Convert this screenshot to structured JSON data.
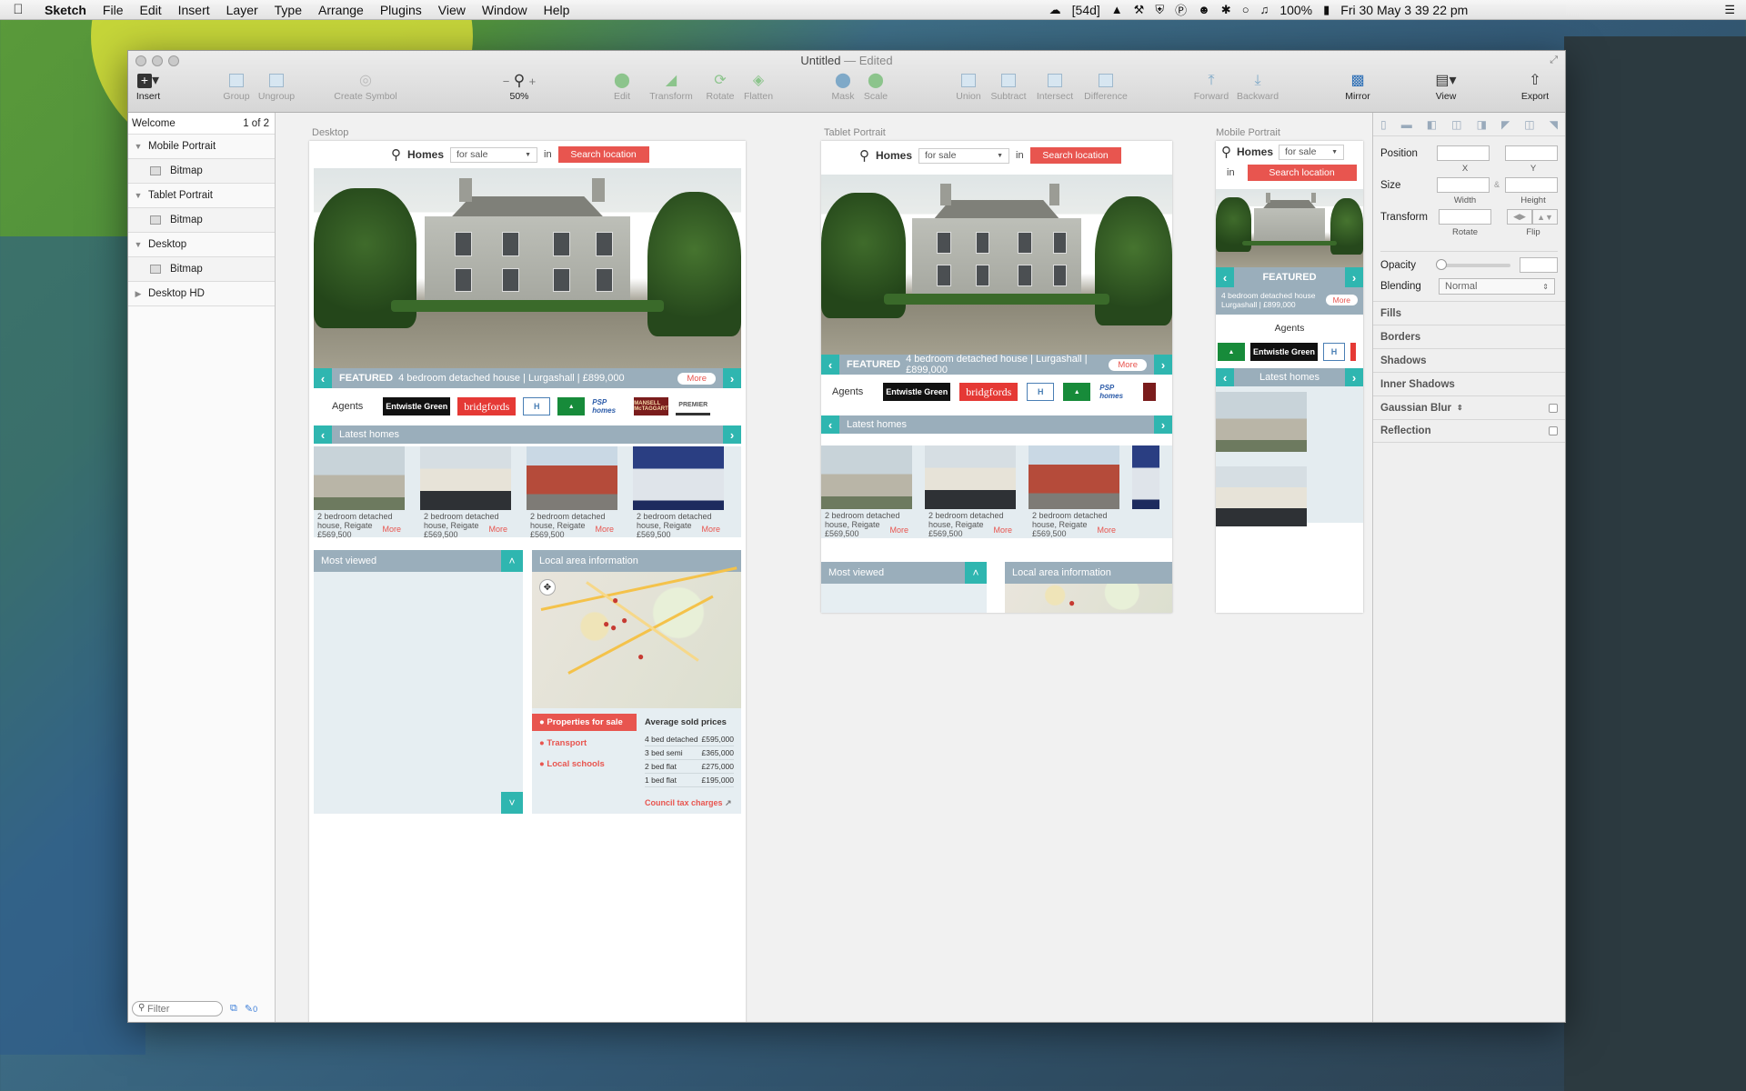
{
  "menubar": {
    "app_name": "Sketch",
    "menus": [
      "File",
      "Edit",
      "Insert",
      "Layer",
      "Type",
      "Arrange",
      "Plugins",
      "View",
      "Window",
      "Help"
    ],
    "status_days": "[54d]",
    "battery": "100%",
    "datetime": "Fri 30 May  3 39 22 pm"
  },
  "window": {
    "title": "Untitled",
    "title_suffix": "— Edited"
  },
  "toolbar": {
    "insert": "Insert",
    "group": "Group",
    "ungroup": "Ungroup",
    "create_symbol": "Create Symbol",
    "zoom_minus": "−",
    "zoom_plus": "+",
    "zoom_level": "50%",
    "edit": "Edit",
    "transform": "Transform",
    "rotate": "Rotate",
    "flatten": "Flatten",
    "mask": "Mask",
    "scale": "Scale",
    "union": "Union",
    "subtract": "Subtract",
    "intersect": "Intersect",
    "difference": "Difference",
    "forward": "Forward",
    "backward": "Backward",
    "mirror": "Mirror",
    "view": "View",
    "export": "Export"
  },
  "layers": {
    "page_name": "Welcome",
    "page_count": "1 of 2",
    "items": [
      {
        "label": "Mobile Portrait"
      },
      {
        "label": "Bitmap"
      },
      {
        "label": "Tablet Portrait"
      },
      {
        "label": "Bitmap"
      },
      {
        "label": "Desktop"
      },
      {
        "label": "Bitmap"
      },
      {
        "label": "Desktop HD"
      }
    ],
    "filter_placeholder": "Filter",
    "edit_count": "0"
  },
  "artboards": {
    "desktop": "Desktop",
    "tablet": "Tablet Portrait",
    "mobile": "Mobile Portrait"
  },
  "site": {
    "homes": "Homes",
    "for_sale": "for sale",
    "in": "in",
    "search_location": "Search location",
    "featured": "FEATURED",
    "featured_desc": "4 bedroom detached house | Lurgashall | £899,000",
    "featured_desc_mobile": "4 bedroom detached house Lurgashall | £899,000",
    "more": "More",
    "agents": "Agents",
    "agent_logos": {
      "eg": "Entwistle Green",
      "bf": "bridgfords",
      "hi": "H",
      "psp": "PSP homes",
      "mm": "MANSELL McTAGGART",
      "pm": "PREMIER"
    },
    "latest_homes": "Latest homes",
    "listing_line1": "2 bedroom detached",
    "listing_line2": "house, Reigate",
    "listing_price": "£569,500",
    "most_viewed": "Most viewed",
    "local_area": "Local area information",
    "properties_for_sale": "Properties for sale",
    "transport": "Transport",
    "local_schools": "Local schools",
    "average_sold": "Average sold prices",
    "prices": [
      {
        "type": "4 bed detached",
        "price": "£595,000"
      },
      {
        "type": "3 bed semi",
        "price": "£365,000"
      },
      {
        "type": "2 bed flat",
        "price": "£275,000"
      },
      {
        "type": "1 bed flat",
        "price": "£195,000"
      }
    ],
    "council_tax": "Council tax charges"
  },
  "inspector": {
    "position": "Position",
    "x": "X",
    "y": "Y",
    "size": "Size",
    "width": "Width",
    "height": "Height",
    "transform": "Transform",
    "rotate": "Rotate",
    "flip": "Flip",
    "opacity": "Opacity",
    "blending": "Blending",
    "blending_value": "Normal",
    "fills": "Fills",
    "borders": "Borders",
    "shadows": "Shadows",
    "inner_shadows": "Inner Shadows",
    "gaussian_blur": "Gaussian Blur",
    "reflection": "Reflection"
  }
}
